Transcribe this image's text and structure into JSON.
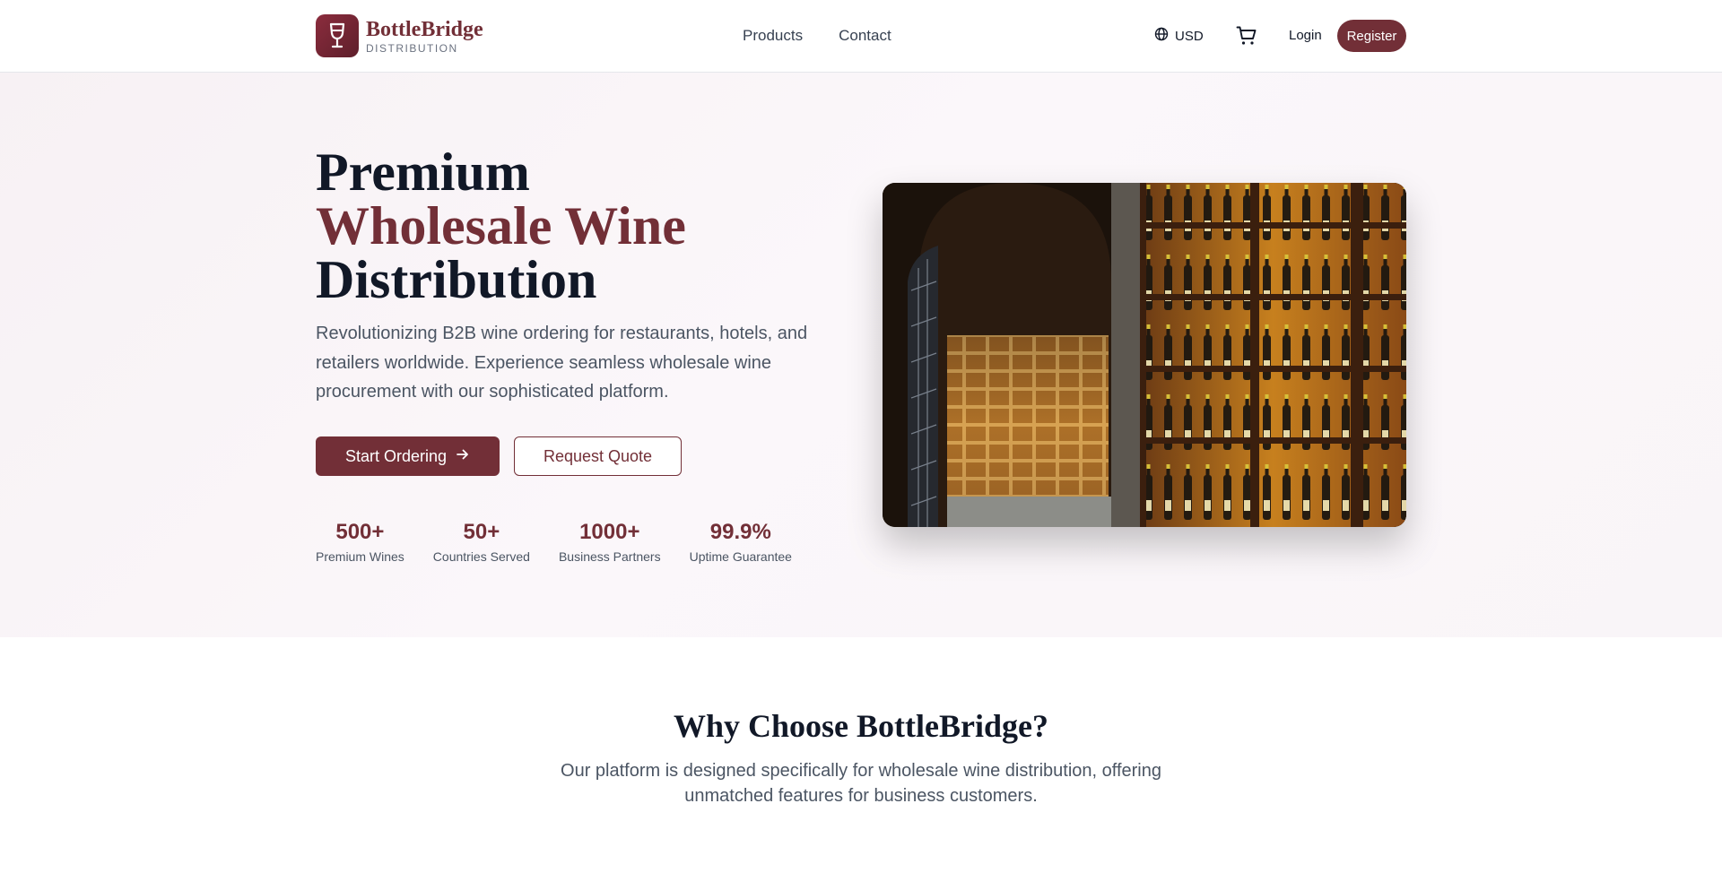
{
  "brand": {
    "name": "BottleBridge",
    "tagline": "DISTRIBUTION",
    "icon": "wine-glass-icon",
    "color": "#722f37"
  },
  "nav": {
    "items": [
      "Products",
      "Contact"
    ]
  },
  "header": {
    "currency": "USD",
    "currency_icon": "globe-icon",
    "cart_icon": "shopping-cart-icon",
    "login_label": "Login",
    "register_label": "Register"
  },
  "hero": {
    "title_line1": "Premium",
    "title_line2": "Wholesale Wine",
    "title_line3": "Distribution",
    "description": "Revolutionizing B2B wine ordering for restaurants, hotels, and retailers worldwide. Experience seamless wholesale wine procurement with our sophisticated platform.",
    "primary_cta": "Start Ordering",
    "primary_cta_icon": "arrow-right-icon",
    "secondary_cta": "Request Quote",
    "stats": [
      {
        "value": "500+",
        "label": "Premium Wines"
      },
      {
        "value": "50+",
        "label": "Countries Served"
      },
      {
        "value": "1000+",
        "label": "Business Partners"
      },
      {
        "value": "99.9%",
        "label": "Uptime Guarantee"
      }
    ]
  },
  "features": {
    "title": "Why Choose BottleBridge?",
    "description": "Our platform is designed specifically for wholesale wine distribution, offering unmatched features for business customers."
  }
}
